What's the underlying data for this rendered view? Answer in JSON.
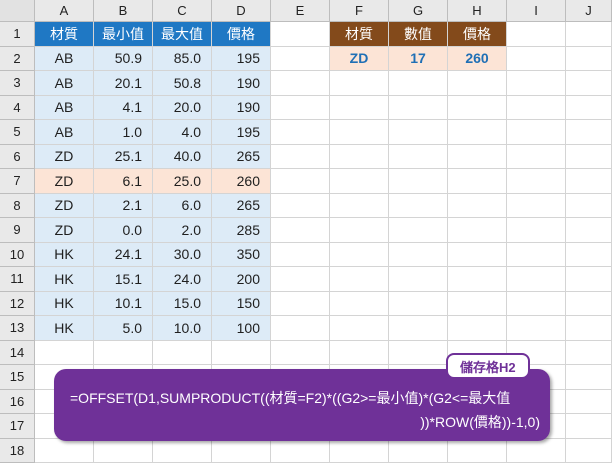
{
  "columns": [
    "A",
    "B",
    "C",
    "D",
    "E",
    "F",
    "G",
    "H",
    "I",
    "J"
  ],
  "rows": [
    "1",
    "2",
    "3",
    "4",
    "5",
    "6",
    "7",
    "8",
    "9",
    "10",
    "11",
    "12",
    "13",
    "14",
    "15",
    "16",
    "17",
    "18"
  ],
  "table": {
    "headers": [
      "材質",
      "最小值",
      "最大值",
      "價格"
    ],
    "data": [
      [
        "AB",
        "50.9",
        "85.0",
        "195"
      ],
      [
        "AB",
        "20.1",
        "50.8",
        "190"
      ],
      [
        "AB",
        "4.1",
        "20.0",
        "190"
      ],
      [
        "AB",
        "1.0",
        "4.0",
        "195"
      ],
      [
        "ZD",
        "25.1",
        "40.0",
        "265"
      ],
      [
        "ZD",
        "6.1",
        "25.0",
        "260"
      ],
      [
        "ZD",
        "2.1",
        "6.0",
        "265"
      ],
      [
        "ZD",
        "0.0",
        "2.0",
        "285"
      ],
      [
        "HK",
        "24.1",
        "30.0",
        "350"
      ],
      [
        "HK",
        "15.1",
        "24.0",
        "200"
      ],
      [
        "HK",
        "10.1",
        "15.0",
        "150"
      ],
      [
        "HK",
        "5.0",
        "10.0",
        "100"
      ]
    ],
    "highlight_row": 5
  },
  "lookup": {
    "headers": [
      "材質",
      "數值",
      "價格"
    ],
    "values": [
      "ZD",
      "17",
      "260"
    ]
  },
  "callout": {
    "tag": "儲存格H2",
    "formula_line1": "=OFFSET(D1,SUMPRODUCT((材質=F2)*((G2>=最小值)*(G2<=最大值",
    "formula_line2": "))*ROW(價格))-1,0)"
  },
  "colors": {
    "table_header": "#1f78c4",
    "lookup_header": "#834a1b",
    "row_fill": "#ddebf7",
    "highlight_fill": "#fce4d6",
    "callout": "#6f3198"
  }
}
